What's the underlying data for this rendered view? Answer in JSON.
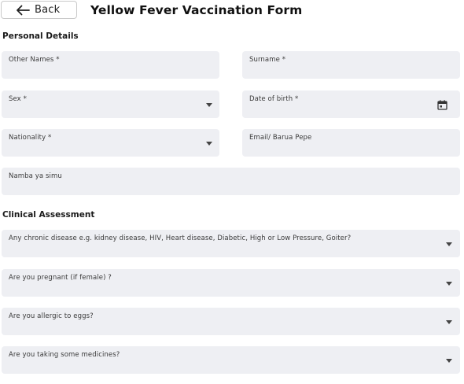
{
  "header": {
    "back_label": "Back",
    "title": "Yellow Fever Vaccination Form"
  },
  "personal": {
    "title": "Personal Details",
    "other_names": "Other Names *",
    "surname": "Surname *",
    "sex": "Sex *",
    "dob": "Date of birth *",
    "nationality": "Nationality *",
    "email": "Email/ Barua Pepe",
    "phone": "Namba ya simu"
  },
  "clinical": {
    "title": "Clinical Assessment",
    "chronic": "Any chronic disease e.g. kidney disease, HIV, Heart disease, Diabetic, High or Low Pressure, Goiter?",
    "pregnant": "Are you pregnant (if female) ?",
    "allergic": "Are you allergic to eggs?",
    "medicines": "Are you taking some medicines?"
  },
  "icons": {
    "back": "arrow-left-icon",
    "dropdown": "caret-down-icon",
    "calendar": "calendar-icon"
  }
}
